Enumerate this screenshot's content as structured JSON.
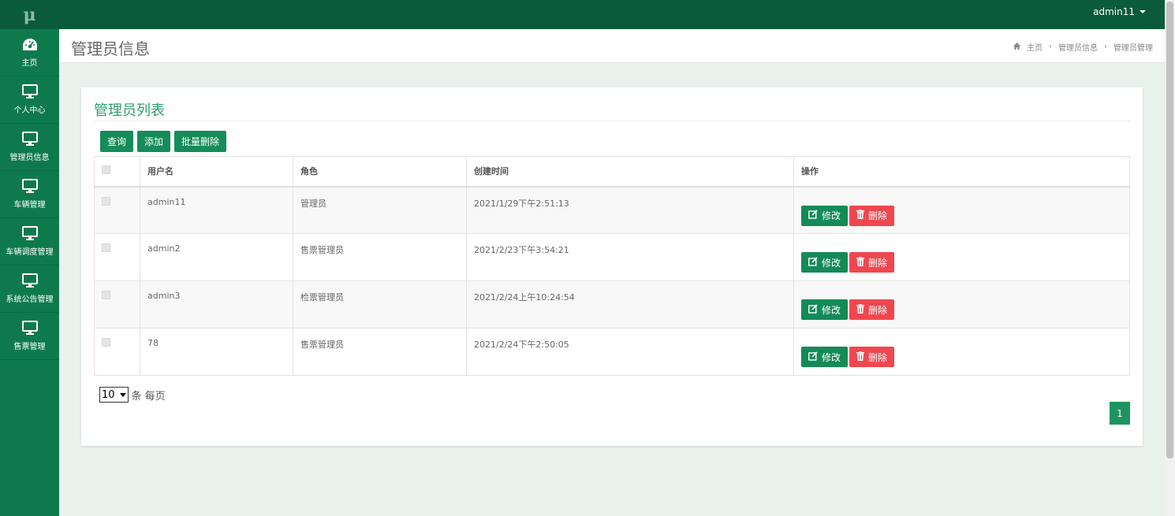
{
  "app": {
    "logo": "μ",
    "user": "admin11"
  },
  "sidebar": {
    "items": [
      {
        "label": "主页",
        "icon": "dashboard-icon"
      },
      {
        "label": "个人中心",
        "icon": "monitor-icon"
      },
      {
        "label": "管理员信息",
        "icon": "monitor-icon"
      },
      {
        "label": "车辆管理",
        "icon": "monitor-icon"
      },
      {
        "label": "车辆调度管理",
        "icon": "monitor-icon"
      },
      {
        "label": "系统公告管理",
        "icon": "monitor-icon"
      },
      {
        "label": "售票管理",
        "icon": "monitor-icon"
      }
    ]
  },
  "header": {
    "title": "管理员信息",
    "breadcrumb": [
      "主页",
      "管理员信息",
      "管理员管理"
    ]
  },
  "panel": {
    "title": "管理员列表",
    "toolbar": {
      "query": "查询",
      "add": "添加",
      "batch_delete": "批量删除"
    },
    "columns": [
      "用户名",
      "角色",
      "创建时间",
      "操作"
    ],
    "rows": [
      {
        "username": "admin11",
        "role": "管理员",
        "created": "2021/1/29下午2:51:13"
      },
      {
        "username": "admin2",
        "role": "售票管理员",
        "created": "2021/2/23下午3:54:21"
      },
      {
        "username": "admin3",
        "role": "检票管理员",
        "created": "2021/2/24上午10:24:54"
      },
      {
        "username": "78",
        "role": "售票管理员",
        "created": "2021/2/24下午2:50:05"
      }
    ],
    "actions": {
      "edit": "修改",
      "delete": "删除"
    },
    "pagination": {
      "page_size": "10",
      "per_page_suffix": "条 每页",
      "current_page": "1"
    }
  },
  "colors": {
    "topbar": "#0a5a3c",
    "sidebar": "#0e7a4c",
    "primary": "#168c5a",
    "danger": "#f0474f",
    "title": "#2e9f6a"
  }
}
